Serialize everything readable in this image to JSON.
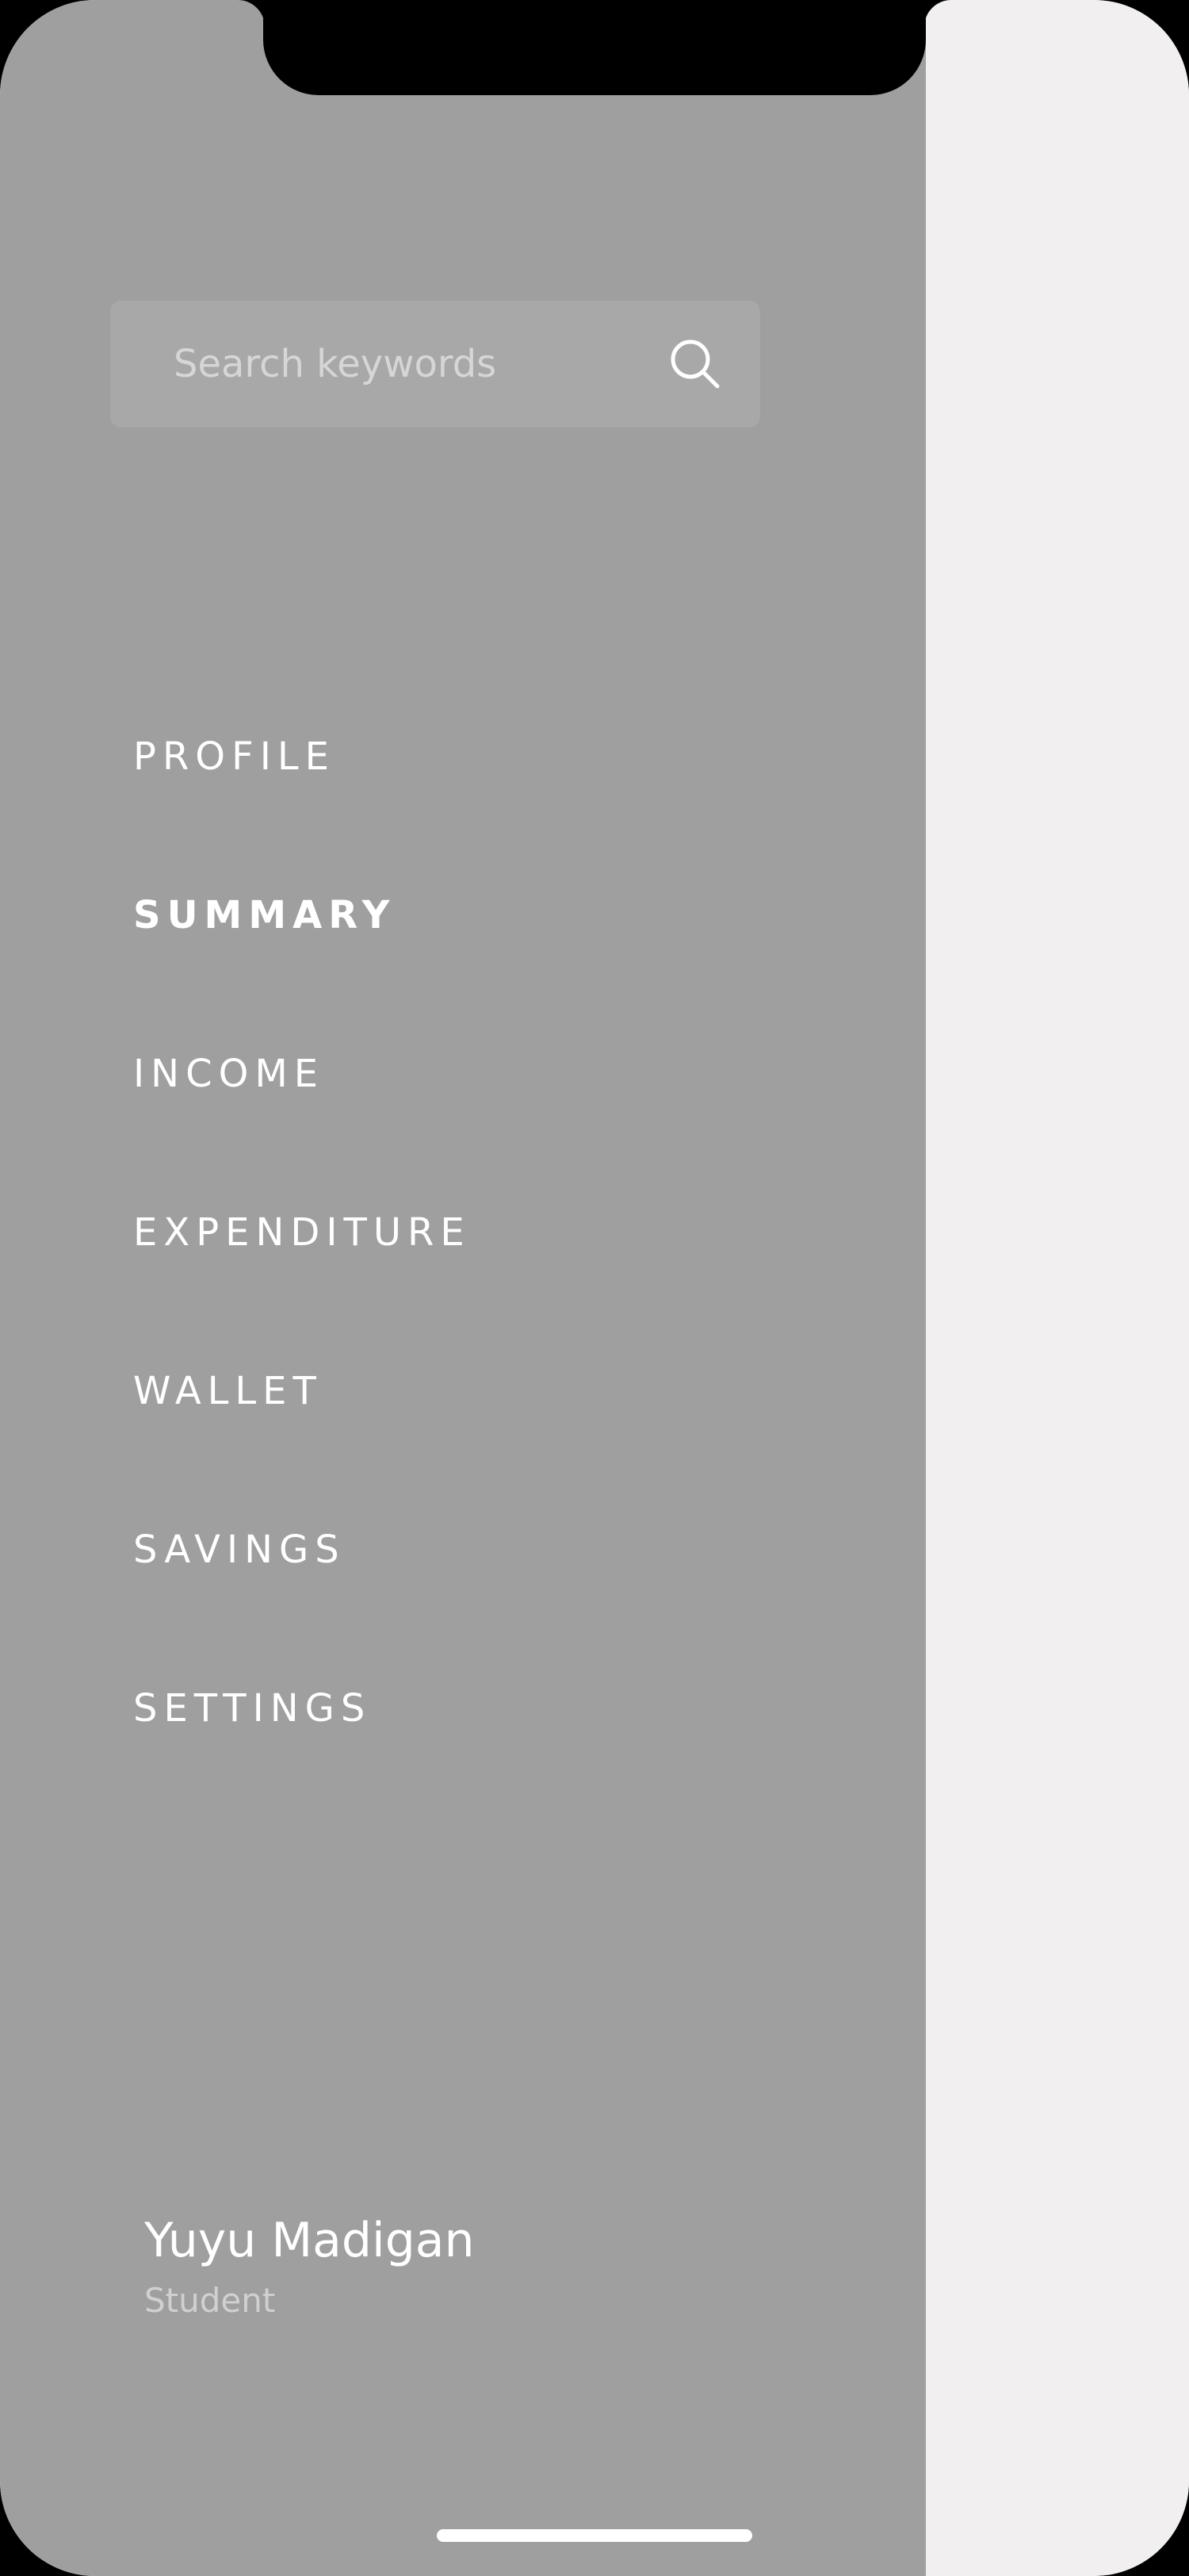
{
  "search": {
    "placeholder": "Search keywords",
    "icon": "search-icon"
  },
  "menu": {
    "items": [
      {
        "label": "PROFILE",
        "active": false
      },
      {
        "label": "SUMMARY",
        "active": true
      },
      {
        "label": "INCOME",
        "active": false
      },
      {
        "label": "EXPENDITURE",
        "active": false
      },
      {
        "label": "WALLET",
        "active": false
      },
      {
        "label": "SAVINGS",
        "active": false
      },
      {
        "label": "SETTINGS",
        "active": false
      }
    ]
  },
  "user": {
    "name": "Yuyu Madigan",
    "role": "Student"
  },
  "colors": {
    "drawer_background": "#9f9f9f",
    "content_background": "#f1eff0",
    "search_background": "#a8a8a8",
    "menu_text": "#ffffff"
  }
}
